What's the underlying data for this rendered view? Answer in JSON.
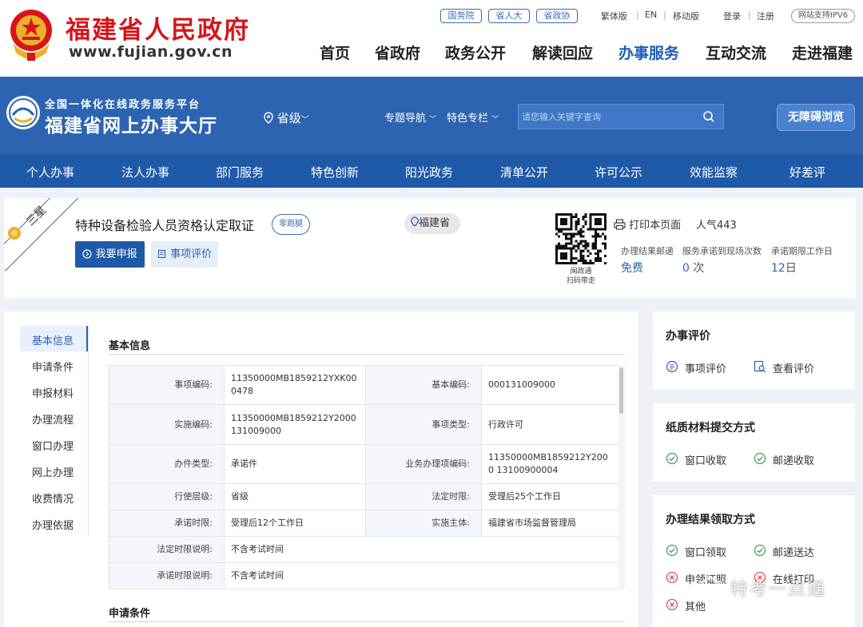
{
  "header": {
    "site_name": "福建省人民政府",
    "site_domain": "www.fujian.gov.cn",
    "pills": [
      "国务院",
      "省人大",
      "省政协"
    ],
    "links": [
      "繁体版",
      "EN",
      "移动版",
      "登录",
      "注册"
    ],
    "ipv6": "网站支持IPV6",
    "nav": [
      "首页",
      "省政府",
      "政务公开",
      "解读回应",
      "办事服务",
      "互动交流",
      "走进福建"
    ],
    "active_nav": "办事服务"
  },
  "banner": {
    "subtitle": "全国一体化在线政务服务平台",
    "title": "福建省网上办事大厅",
    "region": "省级",
    "nav": [
      "专题导航",
      "特色专栏"
    ],
    "search_placeholder": "请您输入关键字查询",
    "accessibility": "无障碍浏览"
  },
  "service_nav": [
    "个人办事",
    "法人办事",
    "部门服务",
    "特色创新",
    "阳光政务",
    "清单公开",
    "许可公示",
    "效能监察",
    "好差评"
  ],
  "item": {
    "rating": "三星",
    "title": "特种设备检验人员资格认定取证",
    "zero_badge": "零跑腿",
    "province": "福建省",
    "apply": "我要申报",
    "evaluate": "事项评价",
    "qr_caption_1": "闽政通",
    "qr_caption_2": "扫码带走",
    "print": "打印本页面",
    "popularity": "人气443",
    "stats": [
      {
        "label": "办理结果邮递",
        "value": "免费",
        "unit": ""
      },
      {
        "label": "服务承诺到现场次数",
        "value": "0",
        "unit": "次"
      },
      {
        "label": "承诺期限工作日",
        "value": "12",
        "unit": "日"
      }
    ]
  },
  "sidebar": [
    "基本信息",
    "申请条件",
    "申报材料",
    "办理流程",
    "窗口办理",
    "网上办理",
    "收费情况",
    "办理依据"
  ],
  "basic_info": {
    "section_title": "基本信息",
    "rows": [
      [
        "事项编码:",
        "11350000MB1859212YXK00 0478",
        "基本编码:",
        "000131009000"
      ],
      [
        "实施编码:",
        "11350000MB1859212Y2000 131009000",
        "事项类型:",
        "行政许可"
      ],
      [
        "办件类型:",
        "承诺件",
        "业务办理项编码:",
        "11350000MB1859212Y2000 13100900004"
      ],
      [
        "行使层级:",
        "省级",
        "法定时限:",
        "受理后25个工作日"
      ],
      [
        "承诺时限:",
        "受理后12个工作日",
        "实施主体:",
        "福建省市场监督管理局"
      ]
    ],
    "wide_rows": [
      [
        "法定时限说明:",
        "不含考试时间"
      ],
      [
        "承诺时限说明:",
        "不含考试时间"
      ]
    ]
  },
  "next_section": "申请条件",
  "evaluation": {
    "title": "办事评价",
    "items": [
      "事项评价",
      "查看评价"
    ]
  },
  "paper": {
    "title": "纸质材料提交方式",
    "items": [
      "窗口收取",
      "邮递收取"
    ]
  },
  "result": {
    "title": "办理结果领取方式",
    "items": [
      {
        "label": "窗口领取",
        "ok": true
      },
      {
        "label": "邮递送达",
        "ok": true
      },
      {
        "label": "申领证照",
        "ok": false
      },
      {
        "label": "在线打印",
        "ok": false
      },
      {
        "label": "其他",
        "ok": false
      }
    ]
  },
  "watermark": "特考一点通",
  "colors": {
    "brand_red": "#d7141a",
    "brand_blue": "#2d64b1",
    "ok_green": "#3aa55a",
    "no_red": "#e05050"
  }
}
